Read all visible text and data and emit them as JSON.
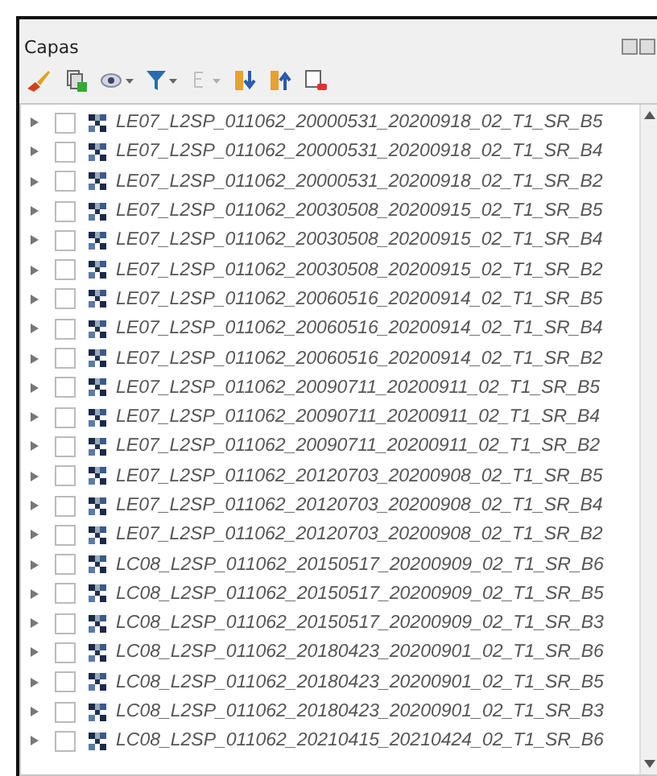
{
  "panel": {
    "title": "Capas"
  },
  "toolbar": [
    {
      "kind": "brush",
      "disabled": false
    },
    {
      "kind": "group",
      "disabled": false
    },
    {
      "kind": "eye",
      "disabled": false
    },
    {
      "kind": "filter",
      "disabled": false
    },
    {
      "kind": "epsilon",
      "disabled": true
    },
    {
      "kind": "expand",
      "disabled": false
    },
    {
      "kind": "collapse",
      "disabled": false
    },
    {
      "kind": "remove",
      "disabled": false
    }
  ],
  "layers": [
    {
      "name": "LE07_L2SP_011062_20000531_20200918_02_T1_SR_B5",
      "checked": false
    },
    {
      "name": "LE07_L2SP_011062_20000531_20200918_02_T1_SR_B4",
      "checked": false
    },
    {
      "name": "LE07_L2SP_011062_20000531_20200918_02_T1_SR_B2",
      "checked": false
    },
    {
      "name": "LE07_L2SP_011062_20030508_20200915_02_T1_SR_B5",
      "checked": false
    },
    {
      "name": "LE07_L2SP_011062_20030508_20200915_02_T1_SR_B4",
      "checked": false
    },
    {
      "name": "LE07_L2SP_011062_20030508_20200915_02_T1_SR_B2",
      "checked": false
    },
    {
      "name": "LE07_L2SP_011062_20060516_20200914_02_T1_SR_B5",
      "checked": false
    },
    {
      "name": "LE07_L2SP_011062_20060516_20200914_02_T1_SR_B4",
      "checked": false
    },
    {
      "name": "LE07_L2SP_011062_20060516_20200914_02_T1_SR_B2",
      "checked": false
    },
    {
      "name": "LE07_L2SP_011062_20090711_20200911_02_T1_SR_B5",
      "checked": false
    },
    {
      "name": "LE07_L2SP_011062_20090711_20200911_02_T1_SR_B4",
      "checked": false
    },
    {
      "name": "LE07_L2SP_011062_20090711_20200911_02_T1_SR_B2",
      "checked": false
    },
    {
      "name": "LE07_L2SP_011062_20120703_20200908_02_T1_SR_B5",
      "checked": false
    },
    {
      "name": "LE07_L2SP_011062_20120703_20200908_02_T1_SR_B4",
      "checked": false
    },
    {
      "name": "LE07_L2SP_011062_20120703_20200908_02_T1_SR_B2",
      "checked": false
    },
    {
      "name": "LC08_L2SP_011062_20150517_20200909_02_T1_SR_B6",
      "checked": false
    },
    {
      "name": "LC08_L2SP_011062_20150517_20200909_02_T1_SR_B5",
      "checked": false
    },
    {
      "name": "LC08_L2SP_011062_20150517_20200909_02_T1_SR_B3",
      "checked": false
    },
    {
      "name": "LC08_L2SP_011062_20180423_20200901_02_T1_SR_B6",
      "checked": false
    },
    {
      "name": "LC08_L2SP_011062_20180423_20200901_02_T1_SR_B5",
      "checked": false
    },
    {
      "name": "LC08_L2SP_011062_20180423_20200901_02_T1_SR_B3",
      "checked": false
    },
    {
      "name": "LC08_L2SP_011062_20210415_20210424_02_T1_SR_B6",
      "checked": false
    }
  ]
}
